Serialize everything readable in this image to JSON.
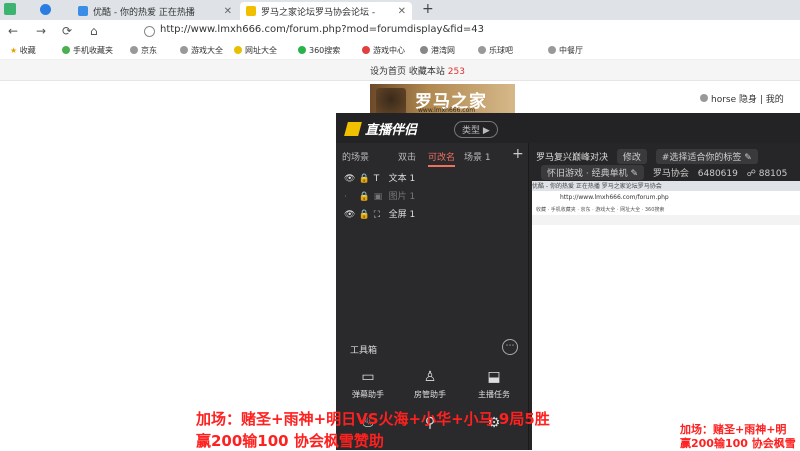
{
  "browser": {
    "tabs": [
      {
        "title": "优酷 - 你的热爱 正在热播"
      },
      {
        "title": "罗马之家论坛罗马协会论坛 - "
      }
    ],
    "new_tab": "+",
    "nav": {
      "back": "←",
      "forward": "→",
      "reload": "⟳",
      "home": "⌂"
    },
    "url": "http://www.lmxh666.com/forum.php?mod=forumdisplay&fid=43",
    "bookmarks": [
      "收藏",
      "手机收藏夹",
      "京东",
      "游戏大全",
      "网址大全",
      "360搜索",
      "游戏中心",
      "港湾网",
      "乐球吧",
      "中餐厅"
    ]
  },
  "site": {
    "links": "设为首页  收藏本站",
    "count": "253",
    "banner_title": "罗马之家",
    "banner_url": "www.lmxh666.com",
    "user": "horse 隐身 | 我的"
  },
  "app": {
    "logo": "直播伴侣",
    "type_btn": "类型 ▶",
    "scene_tabs": [
      "的场景",
      "双击",
      "可改名",
      "场景 1"
    ],
    "sources": [
      {
        "label": "文本 1",
        "visible": true
      },
      {
        "label": "图片 1",
        "visible": false
      },
      {
        "label": "全屏 1",
        "visible": true
      }
    ],
    "tools_label": "工具箱",
    "tools": [
      "弹幕助手",
      "房管助手",
      "主播任务"
    ],
    "live_title": "罗马复兴巅峰对决",
    "edit_btn": "修改",
    "tag_hint": "#选择适合你的标签",
    "category": "怀旧游戏 · 经典单机",
    "club": "罗马协会",
    "club_id": "6480619",
    "viewers": "88105",
    "preview": {
      "tabs": "优酷 - 你的热爱 正在热播      罗马之家论坛罗马协会",
      "url": "http://www.lmxh666.com/forum.php",
      "bookmarks": "收藏 · 手机收藏夹 · 京东 · 游戏大全 · 网址大全 · 360搜索"
    }
  },
  "overlay": {
    "line1": "加场：赌圣+雨神+明日VS火海+小华+小马  9局5胜",
    "line2": "赢200输100 协会枫雪赞助",
    "mini_line1": "加场：赌圣+雨神+明",
    "mini_line2": "赢200输100 协会枫雪"
  },
  "colors": {
    "app_bg": "#262628",
    "accent": "#f07060",
    "caption": "#ff2020"
  }
}
